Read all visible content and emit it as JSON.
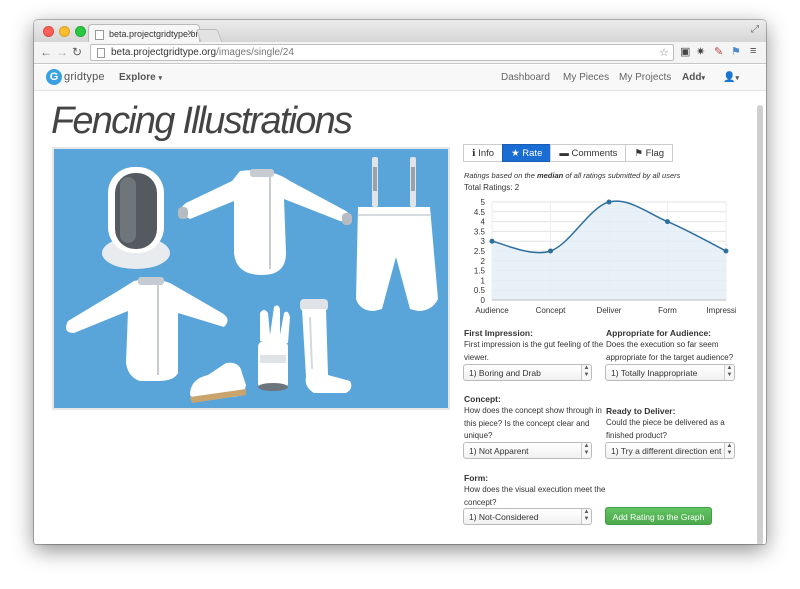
{
  "browser": {
    "tab_title": "beta.projectgridtype.org/i",
    "url_host": "beta.projectgridtype.org",
    "url_path": "/images/single/24"
  },
  "site": {
    "logo_letter": "G",
    "logo_name": "gridtype",
    "explore": "Explore",
    "nav": {
      "dashboard": "Dashboard",
      "my_pieces": "My Pieces",
      "my_projects": "My Projects",
      "add": "Add"
    }
  },
  "page_title": "Fencing Illustrations",
  "tabs": {
    "info": "Info",
    "rate": "Rate",
    "comments": "Comments",
    "flag": "Flag"
  },
  "ratings_note_prefix": "Ratings based on the ",
  "ratings_note_median": "median",
  "ratings_note_suffix": " of all ratings submitted by all users",
  "total_ratings": "Total Ratings: 2",
  "chart_data": {
    "type": "area",
    "categories": [
      "Audience",
      "Concept",
      "Deliver",
      "Form",
      "Impression"
    ],
    "values": [
      3,
      2.5,
      5,
      4,
      2.5
    ],
    "ylim": [
      0,
      5
    ],
    "yticks": [
      "0",
      "0.5",
      "1",
      "1.5",
      "2",
      "2.5",
      "3",
      "3.5",
      "4",
      "4.5",
      "5"
    ],
    "grid": true,
    "colors": {
      "line": "#2e6f9e",
      "fill": "#e3edf6"
    }
  },
  "form": {
    "first_impression": {
      "label": "First Impression:",
      "desc": [
        "First impression is the gut feeling of the",
        "viewer."
      ],
      "value": "1) Boring and Drab"
    },
    "audience": {
      "label": "Appropriate for Audience:",
      "desc": [
        "Does the execution so far seem",
        "appropriate for the target audience?"
      ],
      "value": "1) Totally Inappropriate"
    },
    "concept": {
      "label": "Concept:",
      "desc": [
        "How does the concept show through in",
        "this piece? Is the concept clear and",
        "unique?"
      ],
      "value": "1) Not Apparent"
    },
    "deliver": {
      "label": "Ready to Deliver:",
      "desc": [
        "Could the piece be delivered as a",
        "finished product?"
      ],
      "value": "1) Try a different direction ent"
    },
    "form": {
      "label": "Form:",
      "desc": [
        "How does the visual execution meet the",
        "concept?"
      ],
      "value": "1) Not-Considered"
    },
    "submit": "Add Rating to the Graph"
  },
  "colors": {
    "accent": "#1a6ed3",
    "illustration_bg": "#59a5d9",
    "success": "#5cb85c"
  }
}
